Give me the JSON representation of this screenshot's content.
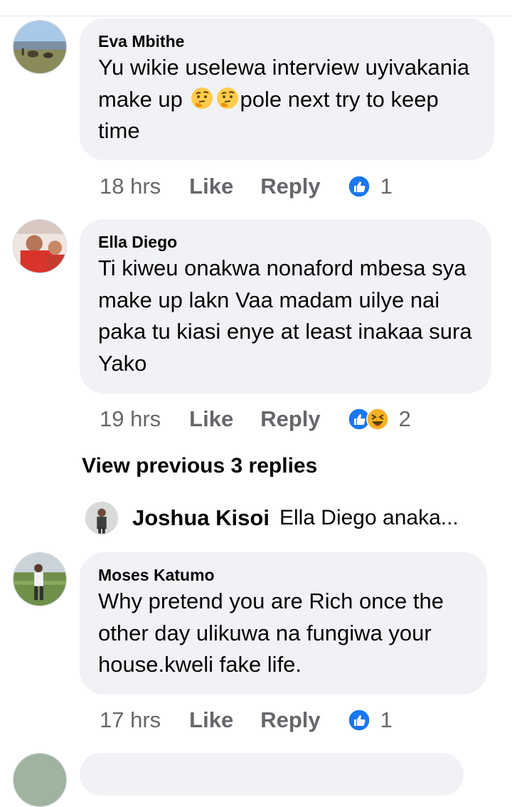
{
  "comments": [
    {
      "author": "Eva Mbithe",
      "text_before": "Yu wikie uselewa interview uyivakania make up",
      "text_after": "pole next try to keep time",
      "time": "18 hrs",
      "like": "Like",
      "reply": "Reply",
      "reaction_count": "1"
    },
    {
      "author": "Ella Diego",
      "text": "Ti kiweu onakwa nonaford mbesa sya make up lakn Vaa madam uilye nai paka tu kiasi enye at least inakaa sura Yako",
      "time": "19 hrs",
      "like": "Like",
      "reply": "Reply",
      "reaction_count": "2"
    },
    {
      "author": "Moses Katumo",
      "text": "Why pretend you are Rich once the other day ulikuwa na fungiwa your house.kweli fake life.",
      "time": "17 hrs",
      "like": "Like",
      "reply": "Reply",
      "reaction_count": "1"
    }
  ],
  "view_previous": "View previous 3 replies",
  "reply_preview": {
    "author": "Joshua Kisoi",
    "text": "Ella Diego anaka..."
  },
  "colors": {
    "bubble": "#f0f2f5",
    "meta_text": "#65676b",
    "like_blue": "#1877f2",
    "haha_yellow": "#f7b125"
  },
  "icons": [
    "thinking-face-icon",
    "like-reaction-icon",
    "haha-reaction-icon"
  ]
}
